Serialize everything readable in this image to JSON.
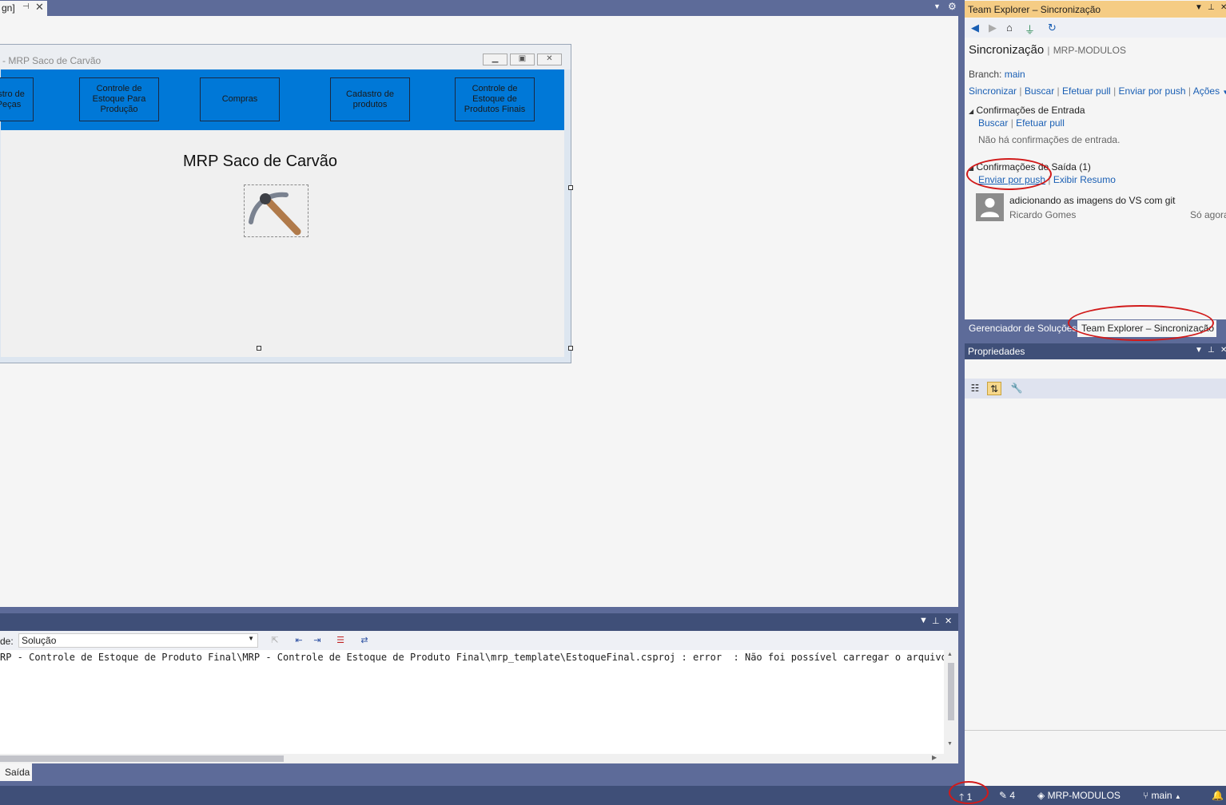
{
  "doc_tab": {
    "label": "gn]",
    "pin": "⊣",
    "close": "✕"
  },
  "form": {
    "title": "- MRP Saco de Carvão",
    "menu_buttons": [
      {
        "label": "astro de\nPeças"
      },
      {
        "label": "Controle de\nEstoque Para\nProdução"
      },
      {
        "label": "Compras"
      },
      {
        "label": "Cadastro de\nprodutos"
      },
      {
        "label": "Controle de\nEstoque de\nProdutos Finais"
      }
    ],
    "app_title": "MRP Saco de Carvão"
  },
  "output": {
    "from_label": "de:",
    "source_value": "Solução",
    "text": "RP - Controle de Estoque de Produto Final\\MRP - Controle de Estoque de Produto Final\\mrp_template\\EstoqueFinal.csproj : error  : Não foi possível carregar o arquivo de p",
    "tab_label": "Saída"
  },
  "team_explorer": {
    "header": "Team Explorer – Sincronização",
    "title": "Sincronização",
    "repo": "MRP-MODULOS",
    "branch_label": "Branch:",
    "branch": "main",
    "actions": [
      "Sincronizar",
      "Buscar",
      "Efetuar pull",
      "Enviar por push",
      "Ações"
    ],
    "incoming": {
      "heading": "Confirmações de Entrada",
      "links": [
        "Buscar",
        "Efetuar pull"
      ],
      "empty": "Não há confirmações de entrada."
    },
    "outgoing": {
      "heading": "Confirmações de Saída (1)",
      "links": [
        "Enviar por push",
        "Exibir Resumo"
      ],
      "commit": {
        "message": "adicionando as imagens do VS com git",
        "author": "Ricardo Gomes",
        "time": "Só agora"
      }
    }
  },
  "bottom_tabs": [
    "Gerenciador de Soluções",
    "Team Explorer – Sincronização"
  ],
  "properties": {
    "header": "Propriedades"
  },
  "statusbar": {
    "push_count": "1",
    "changes_count": "4",
    "repo": "MRP-MODULOS",
    "branch": "main"
  },
  "colors": {
    "form_menu_band": "#0078d7",
    "te_header": "#f5cc84",
    "link": "#1a5fb4",
    "annotation": "#d11a1a"
  }
}
